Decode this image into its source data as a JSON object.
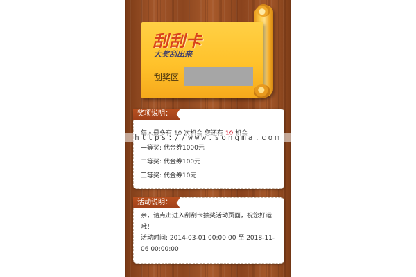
{
  "card": {
    "title": "刮刮卡",
    "subtitle": "大奖刮出来",
    "scratch_label": "刮奖区"
  },
  "prize_info": {
    "heading": "奖项说明：",
    "chances_prefix": "每人最多有 10 次机会 您还有",
    "chances_remaining": "10",
    "chances_suffix": "机会",
    "prizes": [
      "一等奖: 代金券1000元",
      "二等奖: 代金券100元",
      "三等奖: 代金券10元"
    ]
  },
  "activity_info": {
    "heading": "活动说明：",
    "description": "亲，请点击进入刮刮卡抽奖活动页面，祝您好运哦！",
    "time": "活动时间: 2014-03-01 00:00:00 至 2018-11-06 00:00:00"
  },
  "watermark": "https://www.songma.com",
  "colors": {
    "card_yellow": "#ffc22b",
    "title_red": "#d9431b",
    "ribbon": "#a0411a",
    "highlight": "#d0021b",
    "scratch_gray": "#a6a6a6"
  }
}
